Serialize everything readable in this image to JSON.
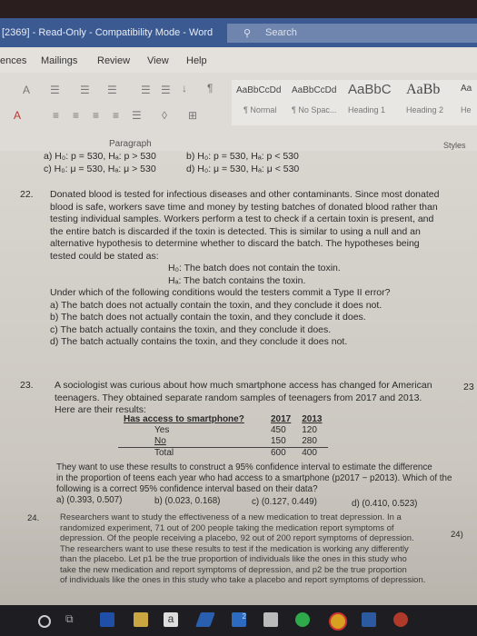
{
  "window": {
    "title": "[2369]  -  Read-Only  -  Compatibility Mode  -  Word",
    "search_placeholder": "Search"
  },
  "tabs": [
    "ences",
    "Mailings",
    "Review",
    "View",
    "Help"
  ],
  "ribbon": {
    "paragraph_label": "Paragraph",
    "styles_label": "Styles",
    "styles": [
      {
        "sample": "AaBbCcDd",
        "name": "¶ Normal"
      },
      {
        "sample": "AaBbCcDd",
        "name": "¶ No Spac..."
      },
      {
        "sample": "AaBbC",
        "name": "Heading 1"
      },
      {
        "sample": "AaBb",
        "name": "Heading 2"
      },
      {
        "sample": "Aa",
        "name": "He"
      }
    ]
  },
  "document": {
    "q21_options": [
      "a)  H₀: p = 530, Hₐ: p > 530",
      "b)  H₀: p = 530, Hₐ: p < 530",
      "c)  H₀: μ = 530, Hₐ: μ > 530",
      "d)  H₀: μ = 530, Hₐ: μ < 530"
    ],
    "q22": {
      "number": "22.",
      "lines": [
        "Donated blood is tested for infectious diseases and other contaminants. Since most donated",
        "blood is safe, workers save time and money by testing batches of donated blood rather than",
        "testing individual samples. Workers perform a test to check if a certain toxin is present, and",
        "the entire batch is discarded if the toxin is detected. This is similar to using a null and an",
        "alternative hypothesis to determine whether to discard the batch. The hypotheses being",
        "tested could be stated as:"
      ],
      "h0": "H₀: The batch does not contain the toxin.",
      "ha": "Hₐ: The batch contains the toxin.",
      "question": "Under which of the following conditions would the testers commit a Type II error?",
      "options": [
        "a) The batch does not actually contain the toxin, and they conclude it does not.",
        "b) The batch does not actually contain the toxin, and they conclude it does.",
        "c) The batch actually contains the toxin, and they conclude it does.",
        "d) The batch actually contains the toxin, and they conclude it does not."
      ]
    },
    "q23": {
      "number": "23.",
      "margin": "23",
      "lines": [
        "A sociologist was curious about how much smartphone access has changed for American",
        "teenagers. They obtained separate random samples of teenagers from 2017 and 2013.",
        "Here are their results:"
      ],
      "table": {
        "headers": [
          "Has access to smartphone?",
          "2017",
          "2013"
        ],
        "rows": [
          [
            "Yes",
            "450",
            "120"
          ],
          [
            "No",
            "150",
            "280"
          ],
          [
            "Total",
            "600",
            "400"
          ]
        ]
      },
      "after": [
        "They want to use these results to construct a 95% confidence interval to estimate the difference",
        "in the proportion of teens each year who had access to a smartphone  (p2017 − p2013).  Which of the",
        "following is a correct 95% confidence interval based on their data?"
      ],
      "options": [
        "a)  (0.393, 0.507)",
        "b)  (0.023, 0.168)",
        "c)  (0.127, 0.449)",
        "d)  (0.410, 0.523)"
      ]
    },
    "q24": {
      "number": "24.",
      "margin": "24)",
      "lines": [
        "Researchers want to study the effectiveness of a new medication to treat depression. In a",
        "randomized experiment, 71 out of 200 people taking the medication report symptoms of",
        "depression. Of the people receiving a placebo, 92 out of 200 report symptoms of depression.",
        "The researchers want to use these results to test if the medication is working any differently",
        "than the placebo.  Let p1 be the true proportion of individuals like the ones in this study who",
        "take the new medication and report symptoms of depression, and p2 be the true proportion",
        "of individuals like the ones in this study who take a placebo and report symptoms of depression."
      ]
    }
  },
  "taskbar": {
    "items": [
      "cortana",
      "task-view",
      "edge",
      "file-explorer",
      "amazon",
      "visual-studio",
      "mail",
      "store",
      "spotify",
      "chrome",
      "word",
      "powerpoint"
    ],
    "mail_badge": "2",
    "amazon_letter": "a"
  }
}
